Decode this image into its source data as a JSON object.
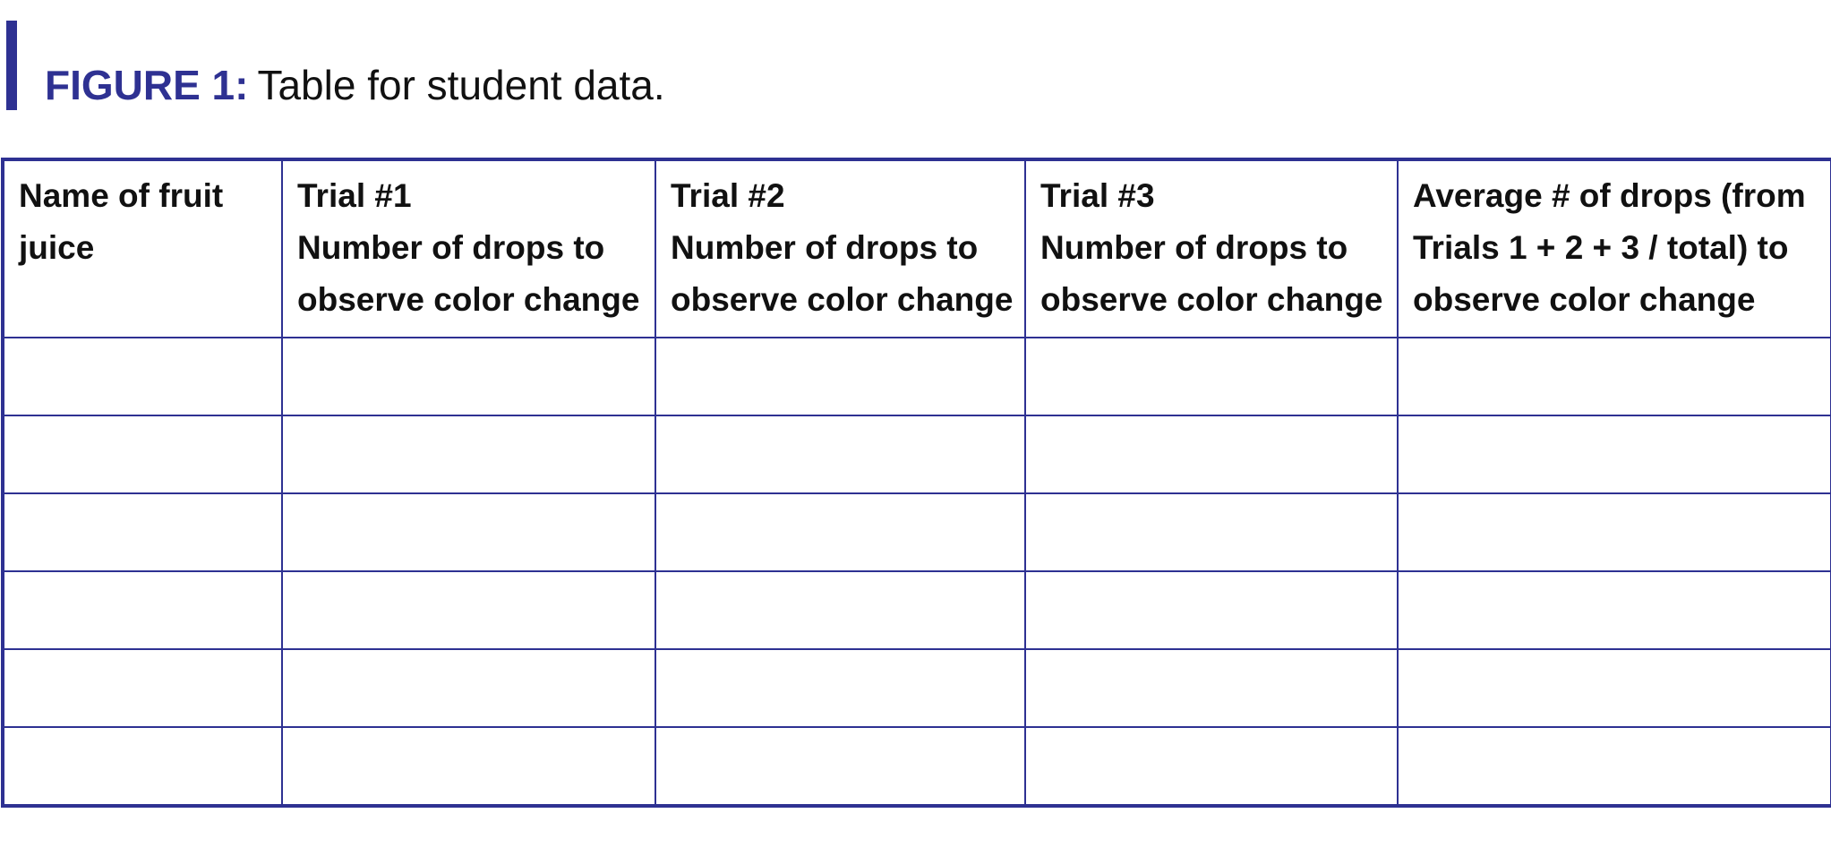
{
  "figure": {
    "label": "FIGURE 1:",
    "caption": "Table for student data.",
    "accent_color": "#2e3192"
  },
  "table": {
    "columns": [
      {
        "lines": [
          "Name of fruit",
          "juice"
        ]
      },
      {
        "lines": [
          "Trial #1",
          "Number of drops to",
          "observe color change"
        ]
      },
      {
        "lines": [
          "Trial #2",
          "Number of drops to",
          "observe color change"
        ]
      },
      {
        "lines": [
          "Trial #3",
          "Number of drops to",
          "observe color change"
        ]
      },
      {
        "lines": [
          "Average # of drops (from",
          "Trials 1 + 2 + 3 / total) to",
          "observe color change"
        ]
      }
    ],
    "rows": [
      [
        "",
        "",
        "",
        "",
        ""
      ],
      [
        "",
        "",
        "",
        "",
        ""
      ],
      [
        "",
        "",
        "",
        "",
        ""
      ],
      [
        "",
        "",
        "",
        "",
        ""
      ],
      [
        "",
        "",
        "",
        "",
        ""
      ],
      [
        "",
        "",
        "",
        "",
        ""
      ]
    ]
  }
}
